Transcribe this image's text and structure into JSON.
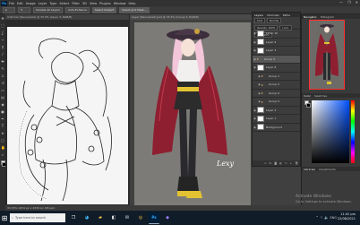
{
  "menubar": {
    "app_logo": "Ps",
    "items": [
      "File",
      "Edit",
      "Image",
      "Layer",
      "Type",
      "Select",
      "Filter",
      "3D",
      "View",
      "Plugins",
      "Window",
      "Help"
    ]
  },
  "options": {
    "buttons": [
      "Sample All Layers",
      "Auto-Enhance",
      "Select Subject",
      "Select and Mask..."
    ],
    "window_controls": [
      "—",
      "❐",
      "✕"
    ]
  },
  "tabs": {
    "doc1": "milk hair (Recovered) @ 33.3% (Layer 3, RGB/8)",
    "doc2": "Layer (Recovered).psd @ 33.3% (Group 3, RGB/8)"
  },
  "layers_panel": {
    "title": "Layers",
    "tabs": [
      "Layers",
      "Channels",
      "Paths"
    ],
    "kind_label": "Kind",
    "blend_mode": "Normal",
    "opacity_label": "Opacity: 100%",
    "lock_label": "Lock:",
    "fill_label": "Fill: 100%",
    "rows": [
      {
        "name": "Layer 10",
        "type": "layer",
        "active": false
      },
      {
        "name": "Layer 9",
        "type": "layer",
        "active": false
      },
      {
        "name": "Layer 3",
        "type": "layer",
        "active": false
      },
      {
        "name": "Group 3",
        "type": "group",
        "active": true
      },
      {
        "name": "Layer 8",
        "type": "layer",
        "active": false
      },
      {
        "name": "Group 1",
        "type": "group",
        "active": false
      },
      {
        "name": "Group 2",
        "type": "group",
        "active": false
      },
      {
        "name": "Group 6",
        "type": "group",
        "active": false
      },
      {
        "name": "Group 5",
        "type": "group",
        "active": false
      },
      {
        "name": "Layer 2",
        "type": "layer",
        "active": false
      },
      {
        "name": "Layer 1",
        "type": "layer",
        "active": false
      },
      {
        "name": "Background",
        "type": "layer",
        "active": false
      }
    ],
    "footer_icons": [
      "link-icon",
      "fx-icon",
      "mask-icon",
      "adjustment-icon",
      "folder-icon",
      "new-layer-icon",
      "trash-icon"
    ]
  },
  "right_panel": {
    "nav_tabs": [
      "Navigator",
      "Histogram"
    ],
    "color_tabs": [
      "Color",
      "Swatches"
    ],
    "bottom_tabs": [
      "Libraries",
      "Adjustments"
    ]
  },
  "status_text": "33.33%   1654 px x 2339 px (96 ppi)",
  "watermark": [
    "Activate Windows",
    "Go to Settings to activate Windows."
  ],
  "taskbar": {
    "search_placeholder": "Type here to search",
    "clock_time": "11:02 pm",
    "clock_date": "22/08/2021",
    "lang": "ENG"
  }
}
